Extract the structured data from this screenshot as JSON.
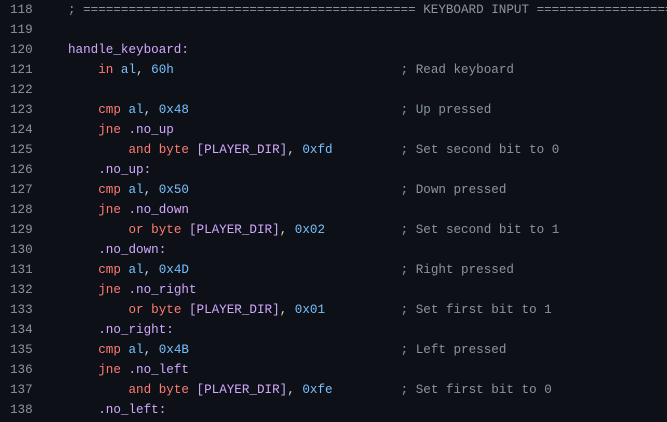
{
  "editor": {
    "lines": [
      {
        "n": "118",
        "tokens": [
          {
            "t": "; ============================================ KEYBOARD INPUT ===================",
            "c": "comment"
          }
        ]
      },
      {
        "n": "119",
        "tokens": []
      },
      {
        "n": "120",
        "tokens": [
          {
            "t": "handle_keyboard:",
            "c": "label"
          }
        ]
      },
      {
        "n": "121",
        "tokens": [
          {
            "t": "    ",
            "c": "plain"
          },
          {
            "t": "in",
            "c": "kw"
          },
          {
            "t": " ",
            "c": "plain"
          },
          {
            "t": "al",
            "c": "reg"
          },
          {
            "t": ", ",
            "c": "punct"
          },
          {
            "t": "60h",
            "c": "num"
          },
          {
            "t": "                              ",
            "c": "plain"
          },
          {
            "t": "; Read keyboard",
            "c": "comment"
          }
        ]
      },
      {
        "n": "122",
        "tokens": []
      },
      {
        "n": "123",
        "tokens": [
          {
            "t": "    ",
            "c": "plain"
          },
          {
            "t": "cmp",
            "c": "kw"
          },
          {
            "t": " ",
            "c": "plain"
          },
          {
            "t": "al",
            "c": "reg"
          },
          {
            "t": ", ",
            "c": "punct"
          },
          {
            "t": "0x48",
            "c": "num"
          },
          {
            "t": "                            ",
            "c": "plain"
          },
          {
            "t": "; Up pressed",
            "c": "comment"
          }
        ]
      },
      {
        "n": "124",
        "tokens": [
          {
            "t": "    ",
            "c": "plain"
          },
          {
            "t": "jne",
            "c": "kw"
          },
          {
            "t": " ",
            "c": "plain"
          },
          {
            "t": ".no_up",
            "c": "label"
          }
        ]
      },
      {
        "n": "125",
        "tokens": [
          {
            "t": "        ",
            "c": "plain"
          },
          {
            "t": "and",
            "c": "kw"
          },
          {
            "t": " ",
            "c": "plain"
          },
          {
            "t": "byte",
            "c": "kw"
          },
          {
            "t": " ",
            "c": "plain"
          },
          {
            "t": "[PLAYER_DIR]",
            "c": "mem"
          },
          {
            "t": ", ",
            "c": "punct"
          },
          {
            "t": "0xfd",
            "c": "num"
          },
          {
            "t": "         ",
            "c": "plain"
          },
          {
            "t": "; Set second bit to 0",
            "c": "comment"
          }
        ]
      },
      {
        "n": "126",
        "tokens": [
          {
            "t": "    ",
            "c": "plain"
          },
          {
            "t": ".no_up:",
            "c": "label"
          }
        ]
      },
      {
        "n": "127",
        "tokens": [
          {
            "t": "    ",
            "c": "plain"
          },
          {
            "t": "cmp",
            "c": "kw"
          },
          {
            "t": " ",
            "c": "plain"
          },
          {
            "t": "al",
            "c": "reg"
          },
          {
            "t": ", ",
            "c": "punct"
          },
          {
            "t": "0x50",
            "c": "num"
          },
          {
            "t": "                            ",
            "c": "plain"
          },
          {
            "t": "; Down pressed",
            "c": "comment"
          }
        ]
      },
      {
        "n": "128",
        "tokens": [
          {
            "t": "    ",
            "c": "plain"
          },
          {
            "t": "jne",
            "c": "kw"
          },
          {
            "t": " ",
            "c": "plain"
          },
          {
            "t": ".no_down",
            "c": "label"
          }
        ]
      },
      {
        "n": "129",
        "tokens": [
          {
            "t": "        ",
            "c": "plain"
          },
          {
            "t": "or",
            "c": "kw"
          },
          {
            "t": " ",
            "c": "plain"
          },
          {
            "t": "byte",
            "c": "kw"
          },
          {
            "t": " ",
            "c": "plain"
          },
          {
            "t": "[PLAYER_DIR]",
            "c": "mem"
          },
          {
            "t": ", ",
            "c": "punct"
          },
          {
            "t": "0x02",
            "c": "num"
          },
          {
            "t": "          ",
            "c": "plain"
          },
          {
            "t": "; Set second bit to 1",
            "c": "comment"
          }
        ]
      },
      {
        "n": "130",
        "tokens": [
          {
            "t": "    ",
            "c": "plain"
          },
          {
            "t": ".no_down:",
            "c": "label"
          }
        ]
      },
      {
        "n": "131",
        "tokens": [
          {
            "t": "    ",
            "c": "plain"
          },
          {
            "t": "cmp",
            "c": "kw"
          },
          {
            "t": " ",
            "c": "plain"
          },
          {
            "t": "al",
            "c": "reg"
          },
          {
            "t": ", ",
            "c": "punct"
          },
          {
            "t": "0x4D",
            "c": "num"
          },
          {
            "t": "                            ",
            "c": "plain"
          },
          {
            "t": "; Right pressed",
            "c": "comment"
          }
        ]
      },
      {
        "n": "132",
        "tokens": [
          {
            "t": "    ",
            "c": "plain"
          },
          {
            "t": "jne",
            "c": "kw"
          },
          {
            "t": " ",
            "c": "plain"
          },
          {
            "t": ".no_right",
            "c": "label"
          }
        ]
      },
      {
        "n": "133",
        "tokens": [
          {
            "t": "        ",
            "c": "plain"
          },
          {
            "t": "or",
            "c": "kw"
          },
          {
            "t": " ",
            "c": "plain"
          },
          {
            "t": "byte",
            "c": "kw"
          },
          {
            "t": " ",
            "c": "plain"
          },
          {
            "t": "[PLAYER_DIR]",
            "c": "mem"
          },
          {
            "t": ", ",
            "c": "punct"
          },
          {
            "t": "0x01",
            "c": "num"
          },
          {
            "t": "          ",
            "c": "plain"
          },
          {
            "t": "; Set first bit to 1",
            "c": "comment"
          }
        ]
      },
      {
        "n": "134",
        "tokens": [
          {
            "t": "    ",
            "c": "plain"
          },
          {
            "t": ".no_right:",
            "c": "label"
          }
        ]
      },
      {
        "n": "135",
        "tokens": [
          {
            "t": "    ",
            "c": "plain"
          },
          {
            "t": "cmp",
            "c": "kw"
          },
          {
            "t": " ",
            "c": "plain"
          },
          {
            "t": "al",
            "c": "reg"
          },
          {
            "t": ", ",
            "c": "punct"
          },
          {
            "t": "0x4B",
            "c": "num"
          },
          {
            "t": "                            ",
            "c": "plain"
          },
          {
            "t": "; Left pressed",
            "c": "comment"
          }
        ]
      },
      {
        "n": "136",
        "tokens": [
          {
            "t": "    ",
            "c": "plain"
          },
          {
            "t": "jne",
            "c": "kw"
          },
          {
            "t": " ",
            "c": "plain"
          },
          {
            "t": ".no_left",
            "c": "label"
          }
        ]
      },
      {
        "n": "137",
        "tokens": [
          {
            "t": "        ",
            "c": "plain"
          },
          {
            "t": "and",
            "c": "kw"
          },
          {
            "t": " ",
            "c": "plain"
          },
          {
            "t": "byte",
            "c": "kw"
          },
          {
            "t": " ",
            "c": "plain"
          },
          {
            "t": "[PLAYER_DIR]",
            "c": "mem"
          },
          {
            "t": ", ",
            "c": "punct"
          },
          {
            "t": "0xfe",
            "c": "num"
          },
          {
            "t": "         ",
            "c": "plain"
          },
          {
            "t": "; Set first bit to 0",
            "c": "comment"
          }
        ]
      },
      {
        "n": "138",
        "tokens": [
          {
            "t": "    ",
            "c": "plain"
          },
          {
            "t": ".no_left:",
            "c": "label"
          }
        ]
      }
    ]
  }
}
